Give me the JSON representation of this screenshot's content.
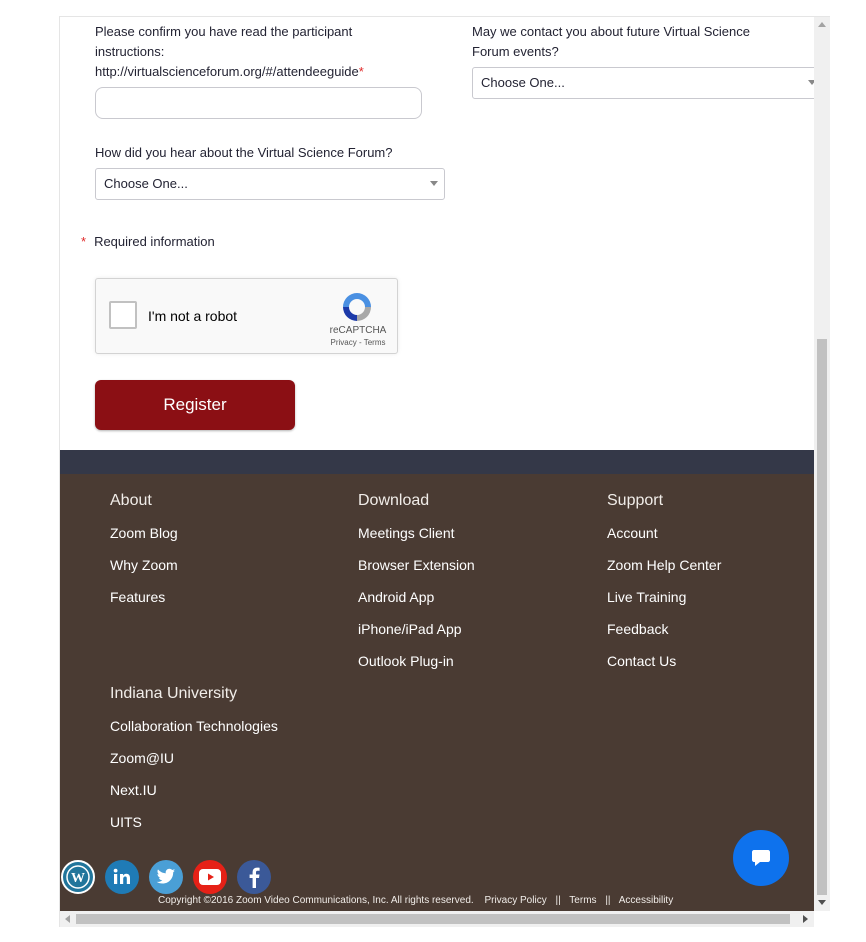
{
  "form": {
    "q_read_instructions": {
      "label_line1": "Please confirm you have read the participant",
      "label_line2": "instructions:",
      "label_line3": "http://virtualscienceforum.org/#/attendeeguide",
      "required_mark": "*",
      "value": ""
    },
    "q_contact": {
      "label_line1": "May we contact you about future Virtual Science",
      "label_line2": "Forum events?",
      "selected": "Choose One..."
    },
    "q_hear_about": {
      "label": "How did you hear about the Virtual Science Forum?",
      "selected": "Choose One..."
    },
    "required_note": {
      "star": "*",
      "text": "Required information"
    },
    "recaptcha": {
      "label": "I'm not a robot",
      "brand": "reCAPTCHA",
      "links": "Privacy - Terms"
    },
    "register_label": "Register"
  },
  "footer": {
    "about": {
      "heading": "About",
      "links": [
        "Zoom Blog",
        "Why Zoom",
        "Features"
      ]
    },
    "download": {
      "heading": "Download",
      "links": [
        "Meetings Client",
        "Browser Extension",
        "Android App",
        "iPhone/iPad App",
        "Outlook Plug-in"
      ]
    },
    "support": {
      "heading": "Support",
      "links": [
        "Account",
        "Zoom Help Center",
        "Live Training",
        "Feedback",
        "Contact Us"
      ]
    },
    "iu": {
      "heading": "Indiana University",
      "links": [
        "Collaboration Technologies",
        "Zoom@IU",
        "Next.IU",
        "UITS"
      ]
    },
    "social_icons": [
      "wordpress-icon",
      "linkedin-icon",
      "twitter-icon",
      "youtube-icon",
      "facebook-icon"
    ],
    "copyright": "Copyright ©2016 Zoom Video Communications, Inc. All rights reserved.",
    "privacy": "Privacy Policy",
    "sep": "||",
    "terms": "Terms",
    "accessibility": "Accessibility"
  },
  "colors": {
    "register": "#8b0f14",
    "footer_bg": "#4a3b33",
    "strip": "#343848",
    "chat": "#0e72ed"
  }
}
